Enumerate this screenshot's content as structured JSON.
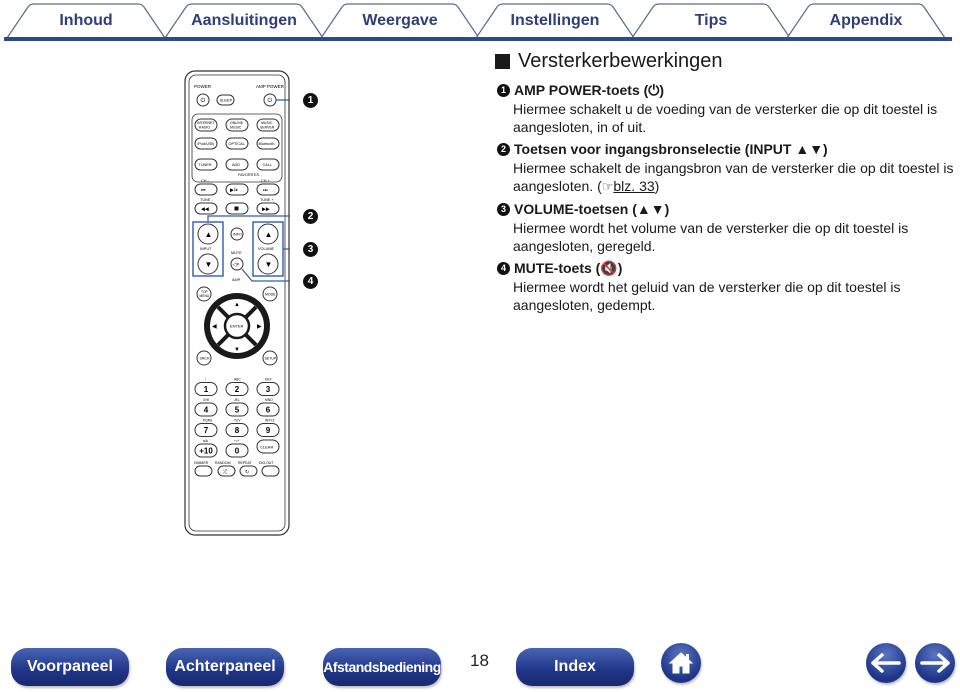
{
  "tabs": [
    {
      "label": "Inhoud"
    },
    {
      "label": "Aansluitingen"
    },
    {
      "label": "Weergave"
    },
    {
      "label": "Instellingen"
    },
    {
      "label": "Tips"
    },
    {
      "label": "Appendix"
    }
  ],
  "remote": {
    "labels": {
      "power": "POWER",
      "amp_power": "AMP POWER",
      "sleep": "SLEEP",
      "internet_radio": "INTERNET RADIO",
      "online_music": "ONLINE MUSIC",
      "music_server": "MUSIC SERVER",
      "ipod_usb": "iPod/USB",
      "optical": "OPTICAL",
      "bluetooth": "Bluetooth",
      "tuner": "TUNER",
      "add": "ADD",
      "call": "CALL",
      "favorites": "FAVORITES",
      "ch_minus": "CH -",
      "ch_plus": "CH +",
      "tune_minus": "TUNE -",
      "tune_plus": "TUNE +",
      "input": "INPUT",
      "info": "INFO",
      "volume": "VOLUME",
      "mute": "MUTE",
      "amp": "AMP",
      "top_menu": "TOP MENU",
      "mode": "MODE",
      "enter": "ENTER",
      "srch": "SRCH",
      "setup": "SETUP",
      "clear": "CLEAR",
      "dimmer": "DIMMER",
      "random": "RANDOM",
      "repeat": "REPEAT",
      "dig_out": "DIG.OUT"
    },
    "keypad": [
      {
        "key": "1",
        "sub": ". /"
      },
      {
        "key": "2",
        "sub": "ABC"
      },
      {
        "key": "3",
        "sub": "DEF"
      },
      {
        "key": "4",
        "sub": "GHI"
      },
      {
        "key": "5",
        "sub": "JKL"
      },
      {
        "key": "6",
        "sub": "MNO"
      },
      {
        "key": "7",
        "sub": "PQRS"
      },
      {
        "key": "8",
        "sub": "TUV"
      },
      {
        "key": "9",
        "sub": "WXYZ"
      },
      {
        "key": "+10",
        "sub": "a/A"
      },
      {
        "key": "0",
        "sub": "+=*"
      }
    ],
    "callouts": [
      "1",
      "2",
      "3",
      "4"
    ]
  },
  "section": {
    "title": "Versterkerbewerkingen",
    "items": [
      {
        "num": "1",
        "title": "AMP POWER-toets (⏻)",
        "body": "Hiermee schakelt u de voeding van de versterker die op dit toestel is aangesloten, in of uit.",
        "link": ""
      },
      {
        "num": "2",
        "title": "Toetsen voor ingangsbronselectie (INPUT ▲▼)",
        "body": "Hiermee schakelt de ingangsbron van de versterker die op dit toestel is aangesloten. (",
        "link": "blz. 33",
        "after": ")"
      },
      {
        "num": "3",
        "title": "VOLUME-toetsen (▲▼)",
        "body": "Hiermee wordt het volume van de versterker die op dit toestel is aangesloten, geregeld.",
        "link": ""
      },
      {
        "num": "4",
        "title": "MUTE-toets (🔇)",
        "body": "Hiermee wordt het geluid van de versterker die op dit toestel is aangesloten, gedempt.",
        "link": ""
      }
    ]
  },
  "footer": {
    "buttons": [
      {
        "label": "Voorpaneel"
      },
      {
        "label": "Achterpaneel"
      },
      {
        "label": "Afstandsbediening"
      },
      {
        "label": "Index"
      }
    ],
    "page_number": "18",
    "home_icon": "home-icon",
    "prev_icon": "arrow-left-icon",
    "next_icon": "arrow-right-icon"
  },
  "colors": {
    "tab_text": "#2f3e7a",
    "tab_line": "#2c4a8e",
    "button_blue": "#1f3488"
  }
}
